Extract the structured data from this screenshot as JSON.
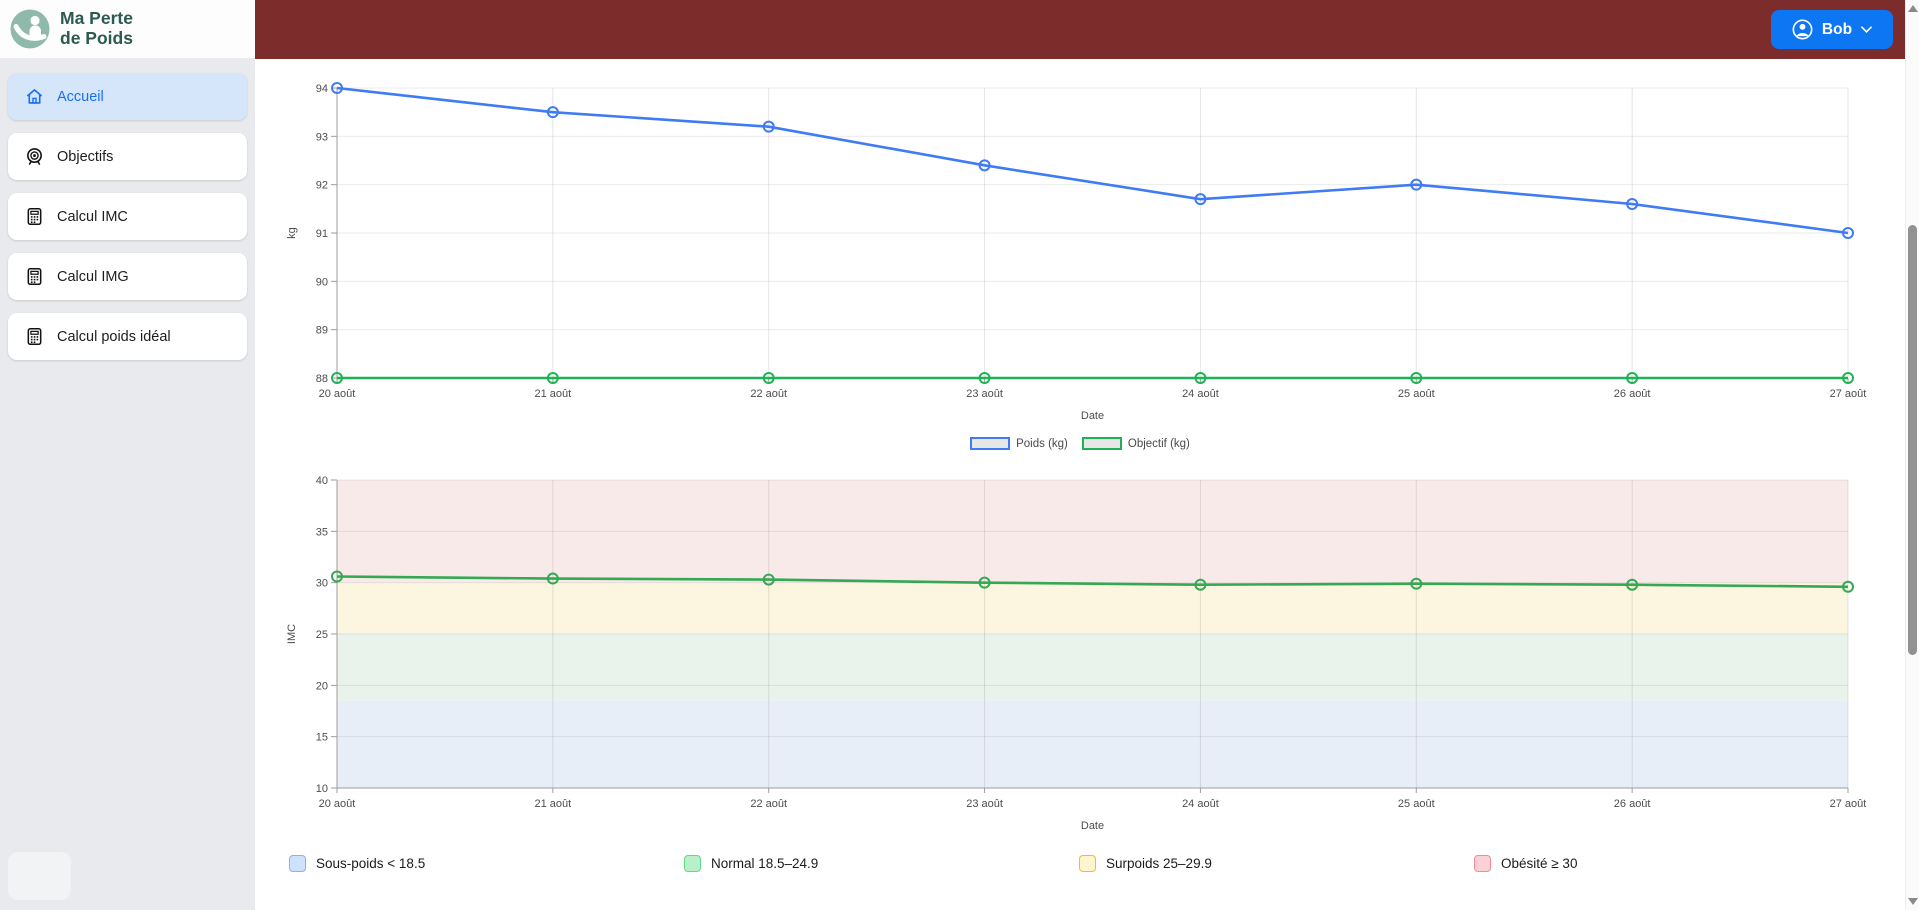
{
  "header": {
    "logo_title_line1": "Ma Perte",
    "logo_title_line2": "de Poids",
    "user_button": {
      "label": "Bob"
    }
  },
  "sidebar": {
    "items": [
      {
        "label": "Accueil",
        "icon": "home-icon",
        "active": true
      },
      {
        "label": "Objectifs",
        "icon": "target-icon",
        "active": false
      },
      {
        "label": "Calcul IMC",
        "icon": "calculator-icon",
        "active": false
      },
      {
        "label": "Calcul IMG",
        "icon": "calculator-icon",
        "active": false
      },
      {
        "label": "Calcul poids idéal",
        "icon": "calculator-icon",
        "active": false
      }
    ]
  },
  "colors": {
    "top_bar": "#7d2c2c",
    "accent_blue": "#0d76f2",
    "sidebar_bg": "#e8eaed",
    "active_item_bg": "#d6e6fa",
    "active_item_text": "#1a6ef5",
    "logo_circle": "#8fb9aa",
    "logo_text": "#2c5a50"
  },
  "chart_data": [
    {
      "type": "line",
      "x": [
        "20 août",
        "21 août",
        "22 août",
        "23 août",
        "24 août",
        "25 août",
        "26 août",
        "27 août"
      ],
      "xlabel": "Date",
      "ylabel": "kg",
      "ylim": [
        88,
        94
      ],
      "ytick_step": 1,
      "grid": true,
      "legend_position": "bottom",
      "legend_swatch_fill": "#e7e7e7",
      "series": [
        {
          "name": "Poids (kg)",
          "color": "#3e7bf5",
          "values": [
            94,
            93.5,
            93.2,
            92.4,
            91.7,
            92,
            91.6,
            91
          ]
        },
        {
          "name": "Objectif (kg)",
          "color": "#1fb254",
          "values": [
            88,
            88,
            88,
            88,
            88,
            88,
            88,
            88
          ]
        }
      ]
    },
    {
      "type": "line",
      "x": [
        "20 août",
        "21 août",
        "22 août",
        "23 août",
        "24 août",
        "25 août",
        "26 août",
        "27 août"
      ],
      "xlabel": "Date",
      "ylabel": "IMC",
      "ylim": [
        10,
        40
      ],
      "ytick_step": 5,
      "grid": true,
      "legend_position": "bottom",
      "series": [
        {
          "name": "IMC",
          "color": "#35a854",
          "values": [
            30.6,
            30.4,
            30.3,
            30,
            29.8,
            29.9,
            29.8,
            29.6
          ]
        }
      ],
      "bands": [
        {
          "label": "Sous-poids < 18.5",
          "from": 10,
          "to": 18.5,
          "fill": "#e8eef8",
          "swatch_fill": "#cfe2fc",
          "swatch_border": "#83b4f6"
        },
        {
          "label": "Normal 18.5–24.9",
          "from": 18.5,
          "to": 25,
          "fill": "#e9f3eb",
          "swatch_fill": "#b8f0c9",
          "swatch_border": "#64d68c"
        },
        {
          "label": "Surpoids 25–29.9",
          "from": 25,
          "to": 30,
          "fill": "#fcf5df",
          "swatch_fill": "#fdf4d0",
          "swatch_border": "#edc211"
        },
        {
          "label": "Obésité ≥ 30",
          "from": 30,
          "to": 40,
          "fill": "#f9eaea",
          "swatch_fill": "#fad2d6",
          "swatch_border": "#f28b96"
        }
      ]
    }
  ]
}
